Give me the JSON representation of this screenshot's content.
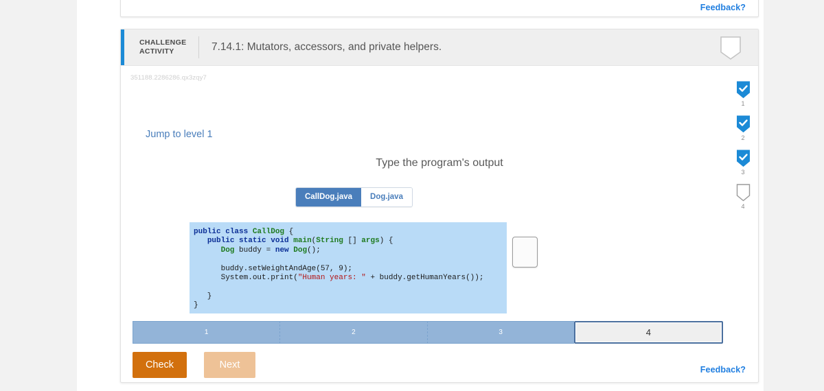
{
  "top_card": {
    "feedback_label": "Feedback?"
  },
  "activity": {
    "kicker_line1": "CHALLENGE",
    "kicker_line2": "ACTIVITY",
    "title": "7.14.1: Mutators, accessors, and private helpers.",
    "id": "351188.2286286.qx3zqy7",
    "jump_link": "Jump to level 1",
    "prompt": "Type the program's output",
    "feedback_label": "Feedback?",
    "answer_value": "",
    "answer_placeholder": ""
  },
  "file_tabs": [
    {
      "label": "CallDog.java",
      "active": true
    },
    {
      "label": "Dog.java",
      "active": false
    }
  ],
  "code": {
    "language": "java",
    "lines": [
      [
        {
          "t": "public ",
          "c": "kw"
        },
        {
          "t": "class ",
          "c": "kw"
        },
        {
          "t": "CallDog",
          "c": "typ"
        },
        {
          "t": " {",
          "c": "pln"
        }
      ],
      [
        {
          "t": "   ",
          "c": "pln"
        },
        {
          "t": "public ",
          "c": "kw"
        },
        {
          "t": "static ",
          "c": "kw"
        },
        {
          "t": "void ",
          "c": "kw"
        },
        {
          "t": "main",
          "c": "typ"
        },
        {
          "t": "(",
          "c": "pln"
        },
        {
          "t": "String",
          "c": "typ"
        },
        {
          "t": " [] ",
          "c": "pln"
        },
        {
          "t": "args",
          "c": "typ"
        },
        {
          "t": ") {",
          "c": "pln"
        }
      ],
      [
        {
          "t": "      ",
          "c": "pln"
        },
        {
          "t": "Dog",
          "c": "typ"
        },
        {
          "t": " buddy = ",
          "c": "pln"
        },
        {
          "t": "new ",
          "c": "kw"
        },
        {
          "t": "Dog",
          "c": "typ"
        },
        {
          "t": "();",
          "c": "pln"
        }
      ],
      [
        {
          "t": "",
          "c": "pln"
        }
      ],
      [
        {
          "t": "      buddy.setWeightAndAge(57, 9);",
          "c": "pln"
        }
      ],
      [
        {
          "t": "      System.out.print(",
          "c": "pln"
        },
        {
          "t": "\"Human years: \"",
          "c": "str"
        },
        {
          "t": " + buddy.getHumanYears());",
          "c": "pln"
        }
      ],
      [
        {
          "t": "",
          "c": "pln"
        }
      ],
      [
        {
          "t": "   }",
          "c": "pln"
        }
      ],
      [
        {
          "t": "}",
          "c": "pln"
        }
      ]
    ]
  },
  "progress": {
    "segments": [
      {
        "label": "1",
        "state": "done"
      },
      {
        "label": "2",
        "state": "done"
      },
      {
        "label": "3",
        "state": "done"
      },
      {
        "label": "4",
        "state": "current"
      }
    ]
  },
  "buttons": {
    "check_label": "Check",
    "next_label": "Next"
  },
  "rail": {
    "items": [
      {
        "number": "1",
        "completed": true
      },
      {
        "number": "2",
        "completed": true
      },
      {
        "number": "3",
        "completed": true
      },
      {
        "number": "4",
        "completed": false
      }
    ]
  },
  "colors": {
    "accent_blue": "#1c8ad6",
    "link_blue": "#1f7ee0",
    "tab_blue": "#4a7ebb",
    "code_bg": "#b9dbf7",
    "progress_fill": "#93b4d8",
    "check_orange": "#d2700d",
    "next_orange": "#eec297",
    "page_bg": "#f2f2f2"
  }
}
